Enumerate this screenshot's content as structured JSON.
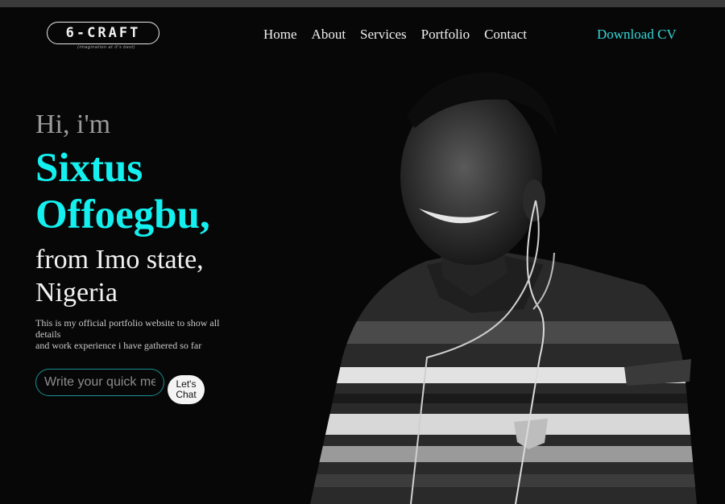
{
  "header": {
    "logo_text": "6-CRAFT",
    "logo_tagline": "(imagination at it's best)",
    "nav": [
      "Home",
      "About",
      "Services",
      "Portfolio",
      "Contact"
    ],
    "download_label": "Download CV"
  },
  "hero": {
    "greeting": "Hi, i'm",
    "name_line1": "Sixtus",
    "name_line2": "Offoegbu,",
    "origin_line1": "from Imo state,",
    "origin_line2": "Nigeria",
    "description_line1": "This is my official portfolio website to show all details",
    "description_line2": "and work experience i have gathered so far"
  },
  "chat": {
    "placeholder": "Write your quick message",
    "button_line1": "Let's",
    "button_line2": "Chat"
  },
  "colors": {
    "background": "#070707",
    "accent": "#14f0ef",
    "link_accent": "#35d6d8"
  }
}
